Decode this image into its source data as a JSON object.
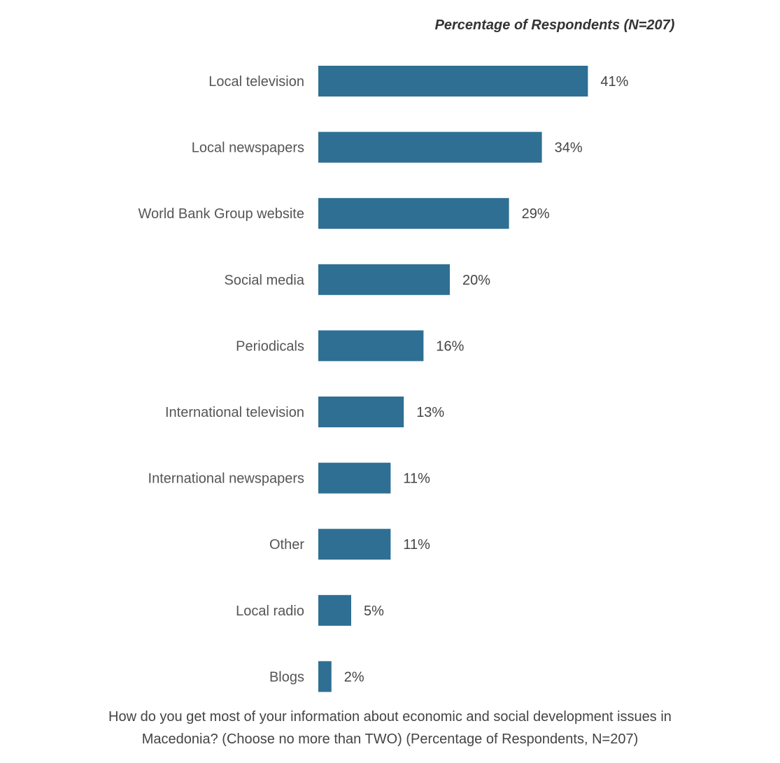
{
  "colors": {
    "bar": "#2f6f93",
    "bar_highlight": "#a9d3ea",
    "text": "#444444",
    "title": "#333333"
  },
  "chart_data": {
    "type": "bar",
    "orientation": "horizontal",
    "title": "Percentage of Respondents (N=207)",
    "categories": [
      "Local television",
      "Local newspapers",
      "World Bank Group website",
      "Social media",
      "Periodicals",
      "International television",
      "International newspapers",
      "Other",
      "Local radio",
      "Blogs"
    ],
    "values": [
      41,
      34,
      29,
      20,
      16,
      13,
      11,
      11,
      5,
      2
    ],
    "value_labels": [
      "41%",
      "34%",
      "29%",
      "20%",
      "16%",
      "13%",
      "11%",
      "11%",
      "5%",
      "2%"
    ],
    "xlim": [
      0,
      100
    ],
    "grid": false,
    "legend": "none"
  },
  "footnotes": {
    "line1": "How do you get most of your information about economic and social development issues in",
    "line2": "Macedonia? (Choose no more than TWO) (Percentage of Respondents, N=207)"
  }
}
